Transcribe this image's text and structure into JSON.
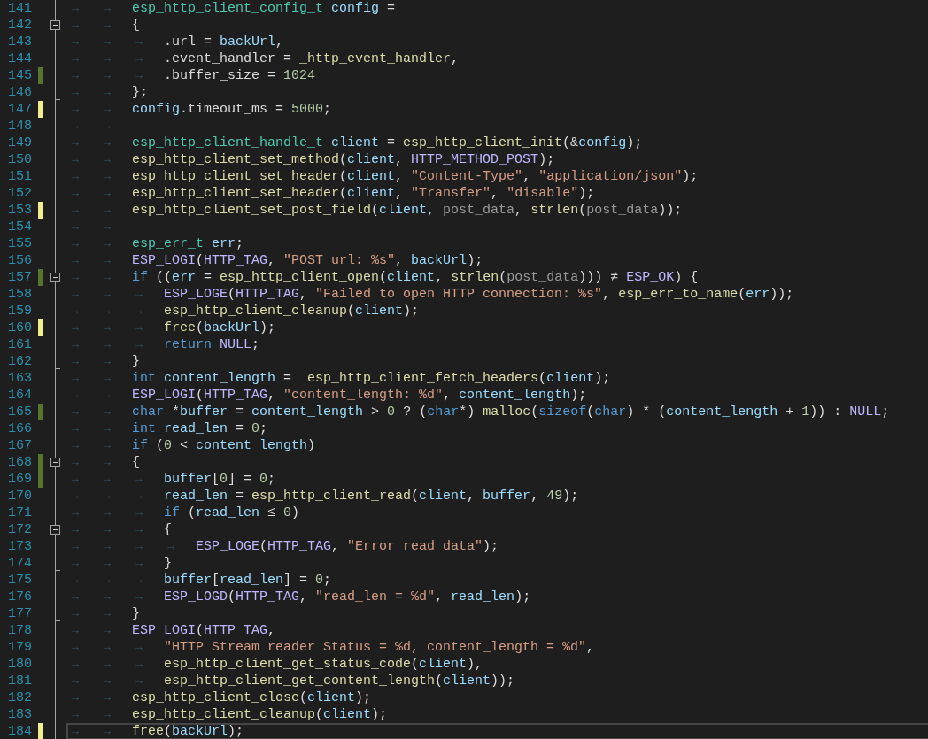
{
  "lines": [
    {
      "number": "141",
      "foldable": false,
      "fold_end": false,
      "current": false,
      "tabs": [
        "→",
        "→"
      ],
      "code": [
        {
          "kind": "type",
          "text": "esp_http_client_config_t"
        },
        {
          "kind": "var",
          "text": " config"
        },
        {
          "kind": "plain",
          "text": " ="
        }
      ]
    },
    {
      "number": "142",
      "foldable": true,
      "fold_end": false,
      "current": false,
      "tabs": [
        "→",
        "→"
      ],
      "code": [
        {
          "kind": "plain",
          "text": "{"
        }
      ]
    },
    {
      "number": "143",
      "foldable": false,
      "fold_end": false,
      "current": false,
      "tabs": [
        "→",
        "→",
        "→"
      ],
      "code": [
        {
          "kind": "plain",
          "text": ".url = "
        },
        {
          "kind": "var",
          "text": "backUrl"
        },
        {
          "kind": "plain",
          "text": ","
        }
      ]
    },
    {
      "number": "144",
      "foldable": false,
      "fold_end": false,
      "current": false,
      "tabs": [
        "→",
        "→",
        "→"
      ],
      "code": [
        {
          "kind": "plain",
          "text": ".event_handler = "
        },
        {
          "kind": "fn",
          "text": "_http_event_handler"
        },
        {
          "kind": "plain",
          "text": ","
        }
      ]
    },
    {
      "number": "145",
      "color": "#57742e",
      "foldable": false,
      "fold_end": false,
      "current": false,
      "tabs": [
        "→",
        "→",
        "→"
      ],
      "code": [
        {
          "kind": "plain",
          "text": ".buffer_size = "
        },
        {
          "kind": "num",
          "text": "1024"
        }
      ]
    },
    {
      "number": "146",
      "foldable": false,
      "fold_end": true,
      "current": false,
      "tabs": [
        "→",
        "→"
      ],
      "code": [
        {
          "kind": "plain",
          "text": "};"
        }
      ]
    },
    {
      "number": "147",
      "color": "#efef91",
      "foldable": false,
      "fold_end": false,
      "current": false,
      "tabs": [
        "→",
        "→"
      ],
      "code": [
        {
          "kind": "var",
          "text": "config"
        },
        {
          "kind": "plain",
          "text": ".timeout_ms = "
        },
        {
          "kind": "num",
          "text": "5000"
        },
        {
          "kind": "plain",
          "text": ";"
        }
      ]
    },
    {
      "number": "148",
      "foldable": false,
      "fold_end": false,
      "current": false,
      "tabs": [
        "→",
        "→"
      ]
    },
    {
      "number": "149",
      "foldable": false,
      "fold_end": false,
      "current": false,
      "tabs": [
        "→",
        "→"
      ],
      "code": [
        {
          "kind": "type",
          "text": "esp_http_client_handle_t"
        },
        {
          "kind": "var",
          "text": " client"
        },
        {
          "kind": "plain",
          "text": " = "
        },
        {
          "kind": "fn",
          "text": "esp_http_client_init"
        },
        {
          "kind": "plain",
          "text": "(&"
        },
        {
          "kind": "var",
          "text": "config"
        },
        {
          "kind": "plain",
          "text": ");"
        }
      ]
    },
    {
      "number": "150",
      "foldable": false,
      "fold_end": false,
      "current": false,
      "tabs": [
        "→",
        "→"
      ],
      "code": [
        {
          "kind": "fn",
          "text": "esp_http_client_set_method"
        },
        {
          "kind": "plain",
          "text": "("
        },
        {
          "kind": "var",
          "text": "client"
        },
        {
          "kind": "plain",
          "text": ", "
        },
        {
          "kind": "macro",
          "text": "HTTP_METHOD_POST"
        },
        {
          "kind": "plain",
          "text": ");"
        }
      ]
    },
    {
      "number": "151",
      "foldable": false,
      "fold_end": false,
      "current": false,
      "tabs": [
        "→",
        "→"
      ],
      "code": [
        {
          "kind": "fn",
          "text": "esp_http_client_set_header"
        },
        {
          "kind": "plain",
          "text": "("
        },
        {
          "kind": "var",
          "text": "client"
        },
        {
          "kind": "plain",
          "text": ", "
        },
        {
          "kind": "str",
          "text": "\"Content-Type\""
        },
        {
          "kind": "plain",
          "text": ", "
        },
        {
          "kind": "str",
          "text": "\"application/json\""
        },
        {
          "kind": "plain",
          "text": ");"
        }
      ]
    },
    {
      "number": "152",
      "foldable": false,
      "fold_end": false,
      "current": false,
      "tabs": [
        "→",
        "→"
      ],
      "code": [
        {
          "kind": "fn",
          "text": "esp_http_client_set_header"
        },
        {
          "kind": "plain",
          "text": "("
        },
        {
          "kind": "var",
          "text": "client"
        },
        {
          "kind": "plain",
          "text": ", "
        },
        {
          "kind": "str",
          "text": "\"Transfer\""
        },
        {
          "kind": "plain",
          "text": ", "
        },
        {
          "kind": "str",
          "text": "\"disable\""
        },
        {
          "kind": "plain",
          "text": ");"
        }
      ]
    },
    {
      "number": "153",
      "color": "#efef91",
      "foldable": false,
      "fold_end": false,
      "current": false,
      "tabs": [
        "→",
        "→"
      ],
      "code": [
        {
          "kind": "fn",
          "text": "esp_http_client_set_post_field"
        },
        {
          "kind": "plain",
          "text": "("
        },
        {
          "kind": "var",
          "text": "client"
        },
        {
          "kind": "plain",
          "text": ", "
        },
        {
          "kind": "param",
          "text": "post_data"
        },
        {
          "kind": "plain",
          "text": ", "
        },
        {
          "kind": "fn",
          "text": "strlen"
        },
        {
          "kind": "plain",
          "text": "("
        },
        {
          "kind": "param",
          "text": "post_data"
        },
        {
          "kind": "plain",
          "text": "));"
        }
      ]
    },
    {
      "number": "154",
      "foldable": false,
      "fold_end": false,
      "current": false,
      "tabs": [
        "→",
        "→"
      ]
    },
    {
      "number": "155",
      "foldable": false,
      "fold_end": false,
      "current": false,
      "tabs": [
        "→",
        "→"
      ],
      "code": [
        {
          "kind": "type",
          "text": "esp_err_t"
        },
        {
          "kind": "var",
          "text": " err"
        },
        {
          "kind": "plain",
          "text": ";"
        }
      ]
    },
    {
      "number": "156",
      "foldable": false,
      "fold_end": false,
      "current": false,
      "tabs": [
        "→",
        "→"
      ],
      "code": [
        {
          "kind": "macro",
          "text": "ESP_LOGI"
        },
        {
          "kind": "plain",
          "text": "("
        },
        {
          "kind": "macro",
          "text": "HTTP_TAG"
        },
        {
          "kind": "plain",
          "text": ", "
        },
        {
          "kind": "str",
          "text": "\"POST url: %s\""
        },
        {
          "kind": "plain",
          "text": ", "
        },
        {
          "kind": "var",
          "text": "backUrl"
        },
        {
          "kind": "plain",
          "text": ");"
        }
      ]
    },
    {
      "number": "157",
      "color": "#57742e",
      "foldable": true,
      "fold_end": false,
      "current": false,
      "tabs": [
        "→",
        "→"
      ],
      "code": [
        {
          "kind": "kw",
          "text": "if"
        },
        {
          "kind": "plain",
          "text": " (("
        },
        {
          "kind": "var",
          "text": "err"
        },
        {
          "kind": "plain",
          "text": " = "
        },
        {
          "kind": "fn",
          "text": "esp_http_client_open"
        },
        {
          "kind": "plain",
          "text": "("
        },
        {
          "kind": "var",
          "text": "client"
        },
        {
          "kind": "plain",
          "text": ", "
        },
        {
          "kind": "fn",
          "text": "strlen"
        },
        {
          "kind": "plain",
          "text": "("
        },
        {
          "kind": "param",
          "text": "post_data"
        },
        {
          "kind": "plain",
          "text": "))) ≠ "
        },
        {
          "kind": "macro",
          "text": "ESP_OK"
        },
        {
          "kind": "plain",
          "text": ") {"
        }
      ]
    },
    {
      "number": "158",
      "foldable": false,
      "fold_end": false,
      "current": false,
      "tabs": [
        "→",
        "→",
        "→"
      ],
      "code": [
        {
          "kind": "macro",
          "text": "ESP_LOGE"
        },
        {
          "kind": "plain",
          "text": "("
        },
        {
          "kind": "macro",
          "text": "HTTP_TAG"
        },
        {
          "kind": "plain",
          "text": ", "
        },
        {
          "kind": "str",
          "text": "\"Failed to open HTTP connection: %s\""
        },
        {
          "kind": "plain",
          "text": ", "
        },
        {
          "kind": "fn",
          "text": "esp_err_to_name"
        },
        {
          "kind": "plain",
          "text": "("
        },
        {
          "kind": "var",
          "text": "err"
        },
        {
          "kind": "plain",
          "text": "));"
        }
      ]
    },
    {
      "number": "159",
      "foldable": false,
      "fold_end": false,
      "current": false,
      "tabs": [
        "→",
        "→",
        "→"
      ],
      "code": [
        {
          "kind": "fn",
          "text": "esp_http_client_cleanup"
        },
        {
          "kind": "plain",
          "text": "("
        },
        {
          "kind": "var",
          "text": "client"
        },
        {
          "kind": "plain",
          "text": ");"
        }
      ]
    },
    {
      "number": "160",
      "color": "#efef91",
      "foldable": false,
      "fold_end": false,
      "current": false,
      "tabs": [
        "→",
        "→",
        "→"
      ],
      "code": [
        {
          "kind": "fn",
          "text": "free"
        },
        {
          "kind": "plain",
          "text": "("
        },
        {
          "kind": "var",
          "text": "backUrl"
        },
        {
          "kind": "plain",
          "text": ");"
        }
      ]
    },
    {
      "number": "161",
      "foldable": false,
      "fold_end": false,
      "current": false,
      "tabs": [
        "→",
        "→",
        "→"
      ],
      "code": [
        {
          "kind": "kw",
          "text": "return"
        },
        {
          "kind": "macro",
          "text": " NULL"
        },
        {
          "kind": "plain",
          "text": ";"
        }
      ]
    },
    {
      "number": "162",
      "foldable": false,
      "fold_end": true,
      "current": false,
      "tabs": [
        "→",
        "→"
      ],
      "code": [
        {
          "kind": "plain",
          "text": "}"
        }
      ]
    },
    {
      "number": "163",
      "foldable": false,
      "fold_end": false,
      "current": false,
      "tabs": [
        "→",
        "→"
      ],
      "code": [
        {
          "kind": "kw",
          "text": "int"
        },
        {
          "kind": "var",
          "text": " content_length"
        },
        {
          "kind": "plain",
          "text": " =  "
        },
        {
          "kind": "fn",
          "text": "esp_http_client_fetch_headers"
        },
        {
          "kind": "plain",
          "text": "("
        },
        {
          "kind": "var",
          "text": "client"
        },
        {
          "kind": "plain",
          "text": ");"
        }
      ]
    },
    {
      "number": "164",
      "foldable": false,
      "fold_end": false,
      "current": false,
      "tabs": [
        "→",
        "→"
      ],
      "code": [
        {
          "kind": "macro",
          "text": "ESP_LOGI"
        },
        {
          "kind": "plain",
          "text": "("
        },
        {
          "kind": "macro",
          "text": "HTTP_TAG"
        },
        {
          "kind": "plain",
          "text": ", "
        },
        {
          "kind": "str",
          "text": "\"content_length: %d\""
        },
        {
          "kind": "plain",
          "text": ", "
        },
        {
          "kind": "var",
          "text": "content_length"
        },
        {
          "kind": "plain",
          "text": ");"
        }
      ]
    },
    {
      "number": "165",
      "color": "#57742e",
      "foldable": false,
      "fold_end": false,
      "current": false,
      "tabs": [
        "→",
        "→"
      ],
      "code": [
        {
          "kind": "kw",
          "text": "char"
        },
        {
          "kind": "plain",
          "text": " *"
        },
        {
          "kind": "var",
          "text": "buffer"
        },
        {
          "kind": "plain",
          "text": " = "
        },
        {
          "kind": "var",
          "text": "content_length"
        },
        {
          "kind": "plain",
          "text": " > "
        },
        {
          "kind": "num",
          "text": "0"
        },
        {
          "kind": "plain",
          "text": " ? ("
        },
        {
          "kind": "kw",
          "text": "char"
        },
        {
          "kind": "plain",
          "text": "*) "
        },
        {
          "kind": "fn",
          "text": "malloc"
        },
        {
          "kind": "plain",
          "text": "("
        },
        {
          "kind": "kw",
          "text": "sizeof"
        },
        {
          "kind": "plain",
          "text": "("
        },
        {
          "kind": "kw",
          "text": "char"
        },
        {
          "kind": "plain",
          "text": ") * ("
        },
        {
          "kind": "var",
          "text": "content_length"
        },
        {
          "kind": "plain",
          "text": " + "
        },
        {
          "kind": "num",
          "text": "1"
        },
        {
          "kind": "plain",
          "text": ")) : "
        },
        {
          "kind": "macro",
          "text": "NULL"
        },
        {
          "kind": "plain",
          "text": ";"
        }
      ]
    },
    {
      "number": "166",
      "foldable": false,
      "fold_end": false,
      "current": false,
      "tabs": [
        "→",
        "→"
      ],
      "code": [
        {
          "kind": "kw",
          "text": "int"
        },
        {
          "kind": "var",
          "text": " read_len"
        },
        {
          "kind": "plain",
          "text": " = "
        },
        {
          "kind": "num",
          "text": "0"
        },
        {
          "kind": "plain",
          "text": ";"
        }
      ]
    },
    {
      "number": "167",
      "foldable": false,
      "fold_end": false,
      "current": false,
      "tabs": [
        "→",
        "→"
      ],
      "code": [
        {
          "kind": "kw",
          "text": "if"
        },
        {
          "kind": "plain",
          "text": " ("
        },
        {
          "kind": "num",
          "text": "0"
        },
        {
          "kind": "plain",
          "text": " < "
        },
        {
          "kind": "var",
          "text": "content_length"
        },
        {
          "kind": "plain",
          "text": ")"
        }
      ]
    },
    {
      "number": "168",
      "color": "#57742e",
      "foldable": true,
      "fold_end": false,
      "current": false,
      "tabs": [
        "→",
        "→"
      ],
      "code": [
        {
          "kind": "plain",
          "text": "{"
        }
      ]
    },
    {
      "number": "169",
      "color": "#57742e",
      "foldable": false,
      "fold_end": false,
      "current": false,
      "tabs": [
        "→",
        "→",
        "→"
      ],
      "code": [
        {
          "kind": "var",
          "text": "buffer"
        },
        {
          "kind": "plain",
          "text": "["
        },
        {
          "kind": "num",
          "text": "0"
        },
        {
          "kind": "plain",
          "text": "] = "
        },
        {
          "kind": "num",
          "text": "0"
        },
        {
          "kind": "plain",
          "text": ";"
        }
      ]
    },
    {
      "number": "170",
      "foldable": false,
      "fold_end": false,
      "current": false,
      "tabs": [
        "→",
        "→",
        "→"
      ],
      "code": [
        {
          "kind": "var",
          "text": "read_len"
        },
        {
          "kind": "plain",
          "text": " = "
        },
        {
          "kind": "fn",
          "text": "esp_http_client_read"
        },
        {
          "kind": "plain",
          "text": "("
        },
        {
          "kind": "var",
          "text": "client"
        },
        {
          "kind": "plain",
          "text": ", "
        },
        {
          "kind": "var",
          "text": "buffer"
        },
        {
          "kind": "plain",
          "text": ", "
        },
        {
          "kind": "num",
          "text": "49"
        },
        {
          "kind": "plain",
          "text": ");"
        }
      ]
    },
    {
      "number": "171",
      "foldable": false,
      "fold_end": false,
      "current": false,
      "tabs": [
        "→",
        "→",
        "→"
      ],
      "code": [
        {
          "kind": "kw",
          "text": "if"
        },
        {
          "kind": "plain",
          "text": " ("
        },
        {
          "kind": "var",
          "text": "read_len"
        },
        {
          "kind": "plain",
          "text": " ≤ "
        },
        {
          "kind": "num",
          "text": "0"
        },
        {
          "kind": "plain",
          "text": ")"
        }
      ]
    },
    {
      "number": "172",
      "foldable": true,
      "fold_end": false,
      "current": false,
      "tabs": [
        "→",
        "→",
        "→"
      ],
      "code": [
        {
          "kind": "plain",
          "text": "{"
        }
      ]
    },
    {
      "number": "173",
      "foldable": false,
      "fold_end": false,
      "current": false,
      "tabs": [
        "→",
        "→",
        "→",
        "→"
      ],
      "code": [
        {
          "kind": "macro",
          "text": "ESP_LOGE"
        },
        {
          "kind": "plain",
          "text": "("
        },
        {
          "kind": "macro",
          "text": "HTTP_TAG"
        },
        {
          "kind": "plain",
          "text": ", "
        },
        {
          "kind": "str",
          "text": "\"Error read data\""
        },
        {
          "kind": "plain",
          "text": ");"
        }
      ]
    },
    {
      "number": "174",
      "foldable": false,
      "fold_end": true,
      "current": false,
      "tabs": [
        "→",
        "→",
        "→"
      ],
      "code": [
        {
          "kind": "plain",
          "text": "}"
        }
      ]
    },
    {
      "number": "175",
      "foldable": false,
      "fold_end": false,
      "current": false,
      "tabs": [
        "→",
        "→",
        "→"
      ],
      "code": [
        {
          "kind": "var",
          "text": "buffer"
        },
        {
          "kind": "plain",
          "text": "["
        },
        {
          "kind": "var",
          "text": "read_len"
        },
        {
          "kind": "plain",
          "text": "] = "
        },
        {
          "kind": "num",
          "text": "0"
        },
        {
          "kind": "plain",
          "text": ";"
        }
      ]
    },
    {
      "number": "176",
      "foldable": false,
      "fold_end": false,
      "current": false,
      "tabs": [
        "→",
        "→",
        "→"
      ],
      "code": [
        {
          "kind": "macro",
          "text": "ESP_LOGD"
        },
        {
          "kind": "plain",
          "text": "("
        },
        {
          "kind": "macro",
          "text": "HTTP_TAG"
        },
        {
          "kind": "plain",
          "text": ", "
        },
        {
          "kind": "str",
          "text": "\"read_len = %d\""
        },
        {
          "kind": "plain",
          "text": ", "
        },
        {
          "kind": "var",
          "text": "read_len"
        },
        {
          "kind": "plain",
          "text": ");"
        }
      ]
    },
    {
      "number": "177",
      "foldable": false,
      "fold_end": true,
      "current": false,
      "tabs": [
        "→",
        "→"
      ],
      "code": [
        {
          "kind": "plain",
          "text": "}"
        }
      ]
    },
    {
      "number": "178",
      "foldable": false,
      "fold_end": false,
      "current": false,
      "tabs": [
        "→",
        "→"
      ],
      "code": [
        {
          "kind": "macro",
          "text": "ESP_LOGI"
        },
        {
          "kind": "plain",
          "text": "("
        },
        {
          "kind": "macro",
          "text": "HTTP_TAG"
        },
        {
          "kind": "plain",
          "text": ","
        }
      ]
    },
    {
      "number": "179",
      "foldable": false,
      "fold_end": false,
      "current": false,
      "tabs": [
        "→",
        "→",
        "→"
      ],
      "code": [
        {
          "kind": "str",
          "text": "\"HTTP Stream reader Status = %d, content_length = %d\""
        },
        {
          "kind": "plain",
          "text": ","
        }
      ]
    },
    {
      "number": "180",
      "foldable": false,
      "fold_end": false,
      "current": false,
      "tabs": [
        "→",
        "→",
        "→"
      ],
      "code": [
        {
          "kind": "fn",
          "text": "esp_http_client_get_status_code"
        },
        {
          "kind": "plain",
          "text": "("
        },
        {
          "kind": "var",
          "text": "client"
        },
        {
          "kind": "plain",
          "text": "),"
        }
      ]
    },
    {
      "number": "181",
      "foldable": false,
      "fold_end": false,
      "current": false,
      "tabs": [
        "→",
        "→",
        "→"
      ],
      "code": [
        {
          "kind": "fn",
          "text": "esp_http_client_get_content_length"
        },
        {
          "kind": "plain",
          "text": "("
        },
        {
          "kind": "var",
          "text": "client"
        },
        {
          "kind": "plain",
          "text": "));"
        }
      ]
    },
    {
      "number": "182",
      "foldable": false,
      "fold_end": false,
      "current": false,
      "tabs": [
        "→",
        "→"
      ],
      "code": [
        {
          "kind": "fn",
          "text": "esp_http_client_close"
        },
        {
          "kind": "plain",
          "text": "("
        },
        {
          "kind": "var",
          "text": "client"
        },
        {
          "kind": "plain",
          "text": ");"
        }
      ]
    },
    {
      "number": "183",
      "foldable": false,
      "fold_end": false,
      "current": false,
      "tabs": [
        "→",
        "→"
      ],
      "code": [
        {
          "kind": "fn",
          "text": "esp_http_client_cleanup"
        },
        {
          "kind": "plain",
          "text": "("
        },
        {
          "kind": "var",
          "text": "client"
        },
        {
          "kind": "plain",
          "text": ");"
        }
      ]
    },
    {
      "number": "184",
      "color": "#efef91",
      "foldable": false,
      "fold_end": false,
      "current": true,
      "tabs": [
        "→",
        "→"
      ],
      "code": [
        {
          "kind": "fn",
          "text": "free"
        },
        {
          "kind": "plain",
          "text": "("
        },
        {
          "kind": "var",
          "text": "backUrl"
        },
        {
          "kind": "plain",
          "text": ");"
        }
      ]
    }
  ]
}
